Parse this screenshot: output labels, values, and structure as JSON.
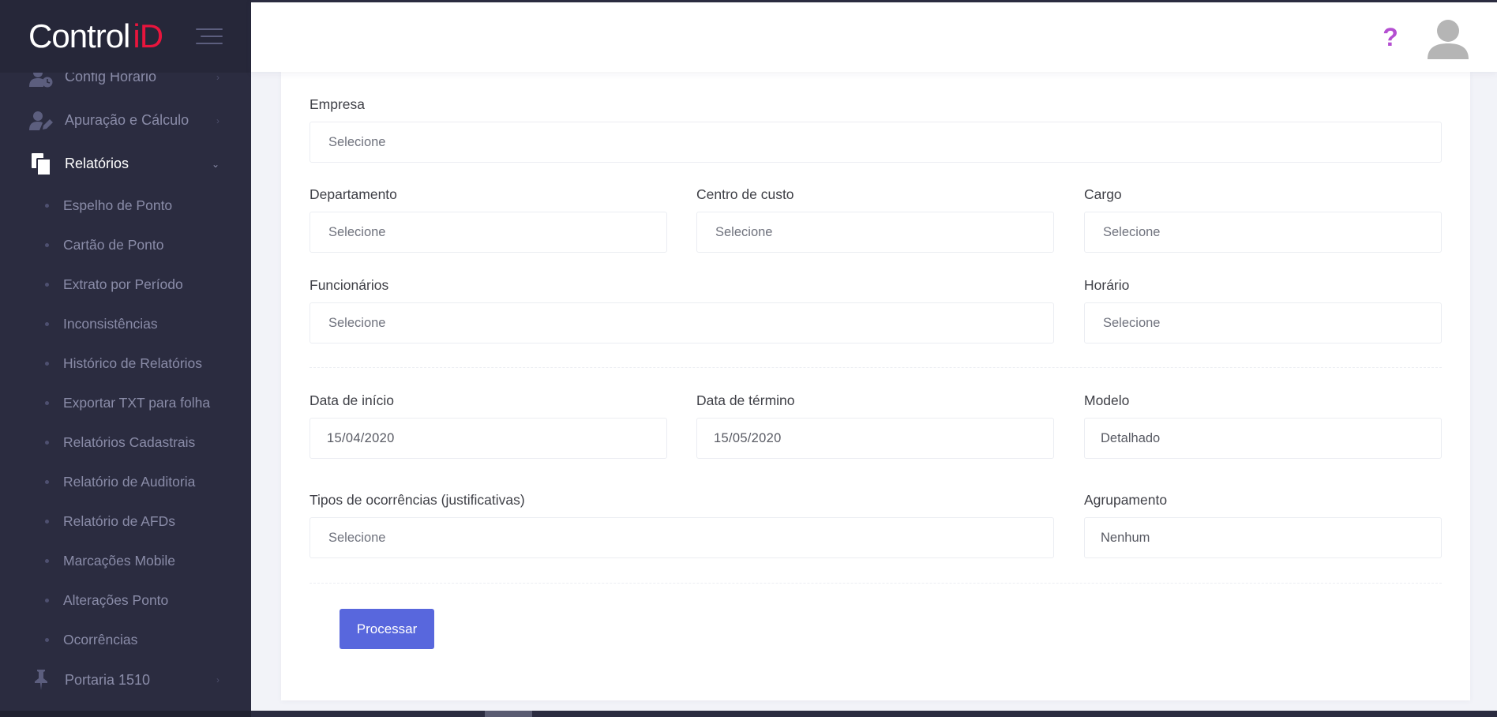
{
  "brand": {
    "name": "Control",
    "accent": "iD"
  },
  "sidebar": {
    "items_top": [
      {
        "label": "Config Horário",
        "icon": "user-clock-icon"
      },
      {
        "label": "Apuração e Cálculo",
        "icon": "user-edit-icon"
      },
      {
        "label": "Relatórios",
        "icon": "copy-documents-icon",
        "active": true
      }
    ],
    "submenu": [
      "Espelho de Ponto",
      "Cartão de Ponto",
      "Extrato por Período",
      "Inconsistências",
      "Histórico de Relatórios",
      "Exportar TXT para folha",
      "Relatórios Cadastrais",
      "Relatório de Auditoria",
      "Relatório de AFDs",
      "Marcações Mobile",
      "Alterações Ponto",
      "Ocorrências"
    ],
    "item_bottom": {
      "label": "Portaria 1510",
      "icon": "pin-icon"
    }
  },
  "header": {
    "help": "?",
    "avatar_icon": "user-avatar-icon"
  },
  "form": {
    "empresa": {
      "label": "Empresa",
      "placeholder": "Selecione"
    },
    "departamento": {
      "label": "Departamento",
      "placeholder": "Selecione"
    },
    "centro_custo": {
      "label": "Centro de custo",
      "placeholder": "Selecione"
    },
    "cargo": {
      "label": "Cargo",
      "placeholder": "Selecione"
    },
    "funcionarios": {
      "label": "Funcionários",
      "placeholder": "Selecione"
    },
    "horario": {
      "label": "Horário",
      "placeholder": "Selecione"
    },
    "data_inicio": {
      "label": "Data de início",
      "value": "15/04/2020"
    },
    "data_termino": {
      "label": "Data de término",
      "value": "15/05/2020"
    },
    "modelo": {
      "label": "Modelo",
      "value": "Detalhado"
    },
    "tipos_ocorrencias": {
      "label": "Tipos de ocorrências (justificativas)",
      "placeholder": "Selecione"
    },
    "agrupamento": {
      "label": "Agrupamento",
      "value": "Nenhum"
    },
    "submit_label": "Processar"
  },
  "colors": {
    "sidebar_bg": "#2b2c40",
    "brand_accent": "#e8153d",
    "primary": "#5867dd",
    "help": "#b44fd1"
  }
}
